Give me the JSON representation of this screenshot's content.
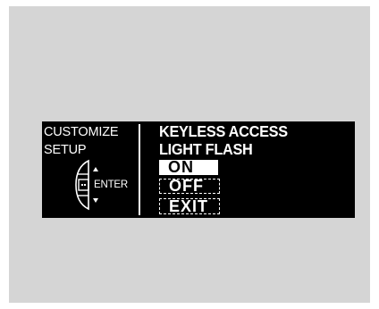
{
  "display": {
    "left_title_line1": "CUSTOMIZE",
    "left_title_line2": "SETUP",
    "enter_label": "ENTER",
    "heading_line1": "KEYLESS ACCESS",
    "heading_line2": "LIGHT FLASH",
    "options": [
      {
        "label": "ON",
        "selected": true
      },
      {
        "label": "OFF",
        "selected": false
      },
      {
        "label": "EXIT",
        "selected": false
      }
    ],
    "icons": {
      "selector_knob": "selector-knob-icon",
      "up_arrow": "up-arrow-icon",
      "down_arrow": "down-arrow-icon",
      "enter_button": "enter-button-icon"
    },
    "colors": {
      "screen_background": "#000000",
      "text": "#ffffff",
      "panel_background": "#d5d5d5"
    }
  }
}
